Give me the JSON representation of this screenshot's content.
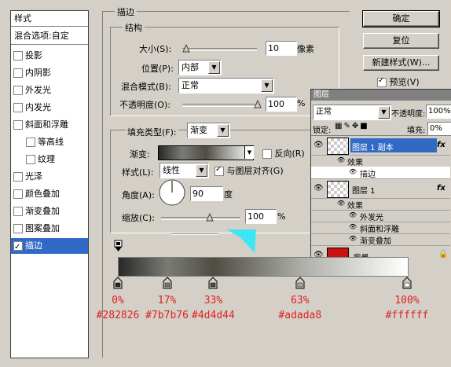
{
  "left_panel": {
    "header": "样式",
    "blend_options": "混合选项:自定",
    "items": [
      {
        "label": "投影",
        "checked": false
      },
      {
        "label": "内阴影",
        "checked": false
      },
      {
        "label": "外发光",
        "checked": false
      },
      {
        "label": "内发光",
        "checked": false
      },
      {
        "label": "斜面和浮雕",
        "checked": false
      },
      {
        "label": "等高线",
        "checked": false
      },
      {
        "label": "纹理",
        "checked": false
      },
      {
        "label": "光泽",
        "checked": false
      },
      {
        "label": "颜色叠加",
        "checked": false
      },
      {
        "label": "渐变叠加",
        "checked": false
      },
      {
        "label": "图案叠加",
        "checked": false
      },
      {
        "label": "描边",
        "checked": true
      }
    ]
  },
  "stroke": {
    "title": "描边",
    "structure_title": "结构",
    "size_label": "大小(S):",
    "size_value": "10",
    "size_unit": "像素",
    "position_label": "位置(P):",
    "position_value": "内部",
    "blend_label": "混合模式(B):",
    "blend_value": "正常",
    "opacity_label": "不透明度(O):",
    "opacity_value": "100",
    "opacity_unit": "%",
    "fill_type_label": "填充类型(F):",
    "fill_type_value": "渐变",
    "gradient_label": "渐变:",
    "reverse_label": "反向(R)",
    "style_label": "样式(L):",
    "style_value": "线性",
    "align_label": "与图层对齐(G)",
    "angle_label": "角度(A):",
    "angle_value": "90",
    "angle_unit": "度",
    "scale_label": "缩放(C):",
    "scale_value": "100",
    "scale_unit": "%"
  },
  "buttons": {
    "ok": "确定",
    "cancel": "复位",
    "new_style": "新建样式(W)...",
    "preview": "预览(V)"
  },
  "layers_panel": {
    "title": "图层",
    "blend": "正常",
    "opacity_label": "不透明度:",
    "opacity_value": "100%",
    "lock_label": "锁定:",
    "fill_label": "填充:",
    "fill_value": "0%",
    "layer1_copy": "图层 1 副本",
    "effects": "效果",
    "stroke_effect": "描边",
    "layer1": "图层 1",
    "effects2": "效果",
    "outer_glow": "外发光",
    "bevel": "斜面和浮雕",
    "grad_overlay": "渐变叠加",
    "background": "背景",
    "fx": "fx"
  },
  "gradient_stops": [
    {
      "pct": "0%",
      "hex": "#282826",
      "pos": 0
    },
    {
      "pct": "17%",
      "hex": "#7b7b76",
      "pos": 0.17
    },
    {
      "pct": "33%",
      "hex": "#4d4d44",
      "pos": 0.33
    },
    {
      "pct": "63%",
      "hex": "#adada8",
      "pos": 0.63
    },
    {
      "pct": "100%",
      "hex": "#ffffff",
      "pos": 1.0
    }
  ],
  "colors": {
    "annotation": "#e02020",
    "selection": "#316ac5",
    "background_thumb": "#cc1111"
  }
}
